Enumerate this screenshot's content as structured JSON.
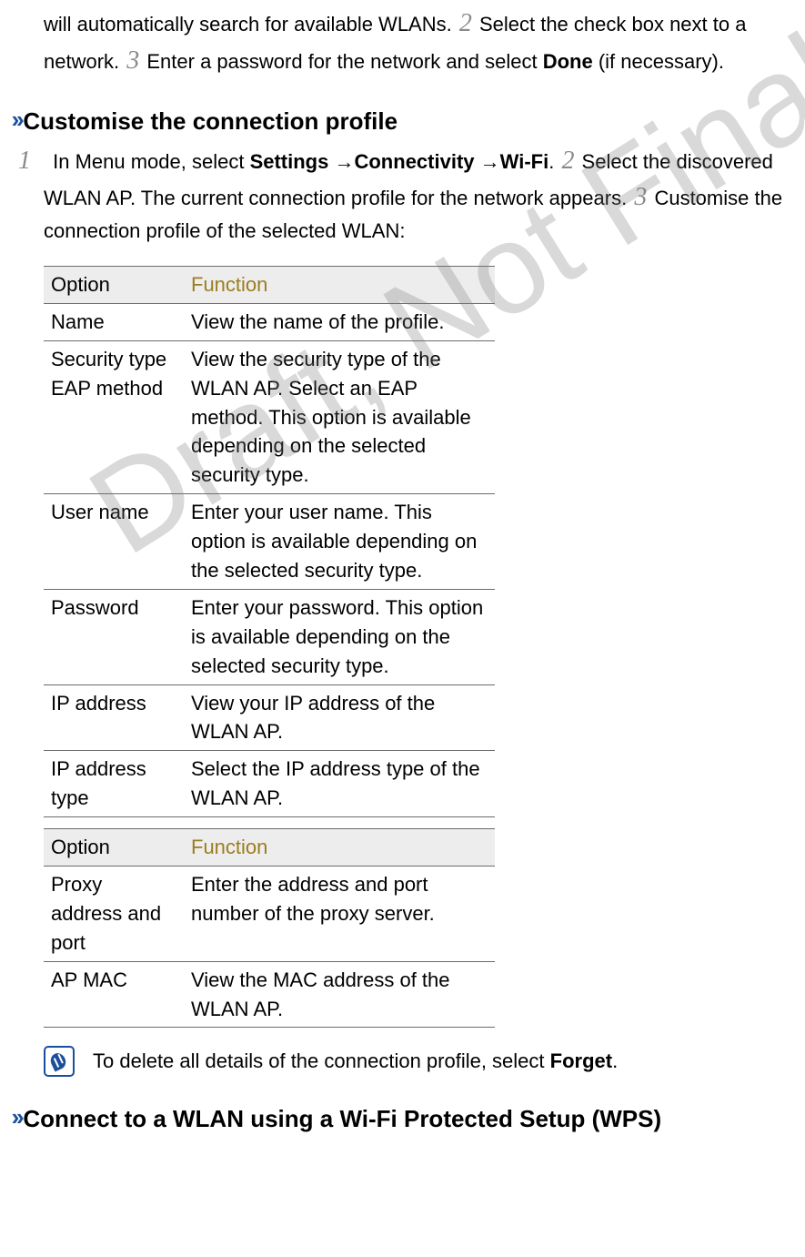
{
  "intro": {
    "p1_a": "will automatically search for available WLANs. ",
    "s2_num": "2",
    "p1_b": " Select the check box next to a network. ",
    "s3_num": "3",
    "p1_c": " Enter a password for the network and select ",
    "done": "Done",
    "p1_d": " (if necessary)."
  },
  "section1": {
    "title": "Customise the connection profile",
    "s1_num": "1",
    "s1_a": " In Menu mode, select ",
    "settings": "Settings",
    "arrow1": " →",
    "connectivity": "Connectivity",
    "arrow2": " →",
    "wifi": "Wi-Fi",
    "s1_b": ". ",
    "s2_num": "2",
    "s2_a": " Select the discovered WLAN AP. The current connection profile for the network appears. ",
    "s3_num": "3",
    "s3_a": " Customise the connection profile of the selected WLAN:"
  },
  "table1": {
    "h_option": "Option",
    "h_function": "Function",
    "rows": [
      {
        "opt": "Name",
        "fn": "View the name of the profile."
      },
      {
        "opt": "Security type EAP method",
        "fn": "View the security type of the WLAN AP. Select an EAP method. This option is available depending on the selected security type."
      },
      {
        "opt": "User name",
        "fn": "Enter your user name. This option is available depending on the selected security type."
      },
      {
        "opt": "Password",
        "fn": "Enter your password. This option is available depending on the selected security type."
      },
      {
        "opt": "IP address",
        "fn": "View your IP address of the WLAN AP."
      },
      {
        "opt": "IP address type",
        "fn": "Select the IP address type of the WLAN AP."
      }
    ]
  },
  "table2": {
    "h_option": "Option",
    "h_function": "Function",
    "rows": [
      {
        "opt": "Proxy address and port",
        "fn": "Enter the address and port number of the proxy server."
      },
      {
        "opt": "AP MAC",
        "fn": "View the MAC address of the WLAN AP."
      }
    ]
  },
  "note": {
    "text_a": "To delete all details of the connection profile, select ",
    "forget": "Forget",
    "text_b": "."
  },
  "section2": {
    "title": "Connect to a WLAN using a Wi-Fi Protected Setup (WPS)"
  },
  "watermark": "Draft, Not Final"
}
